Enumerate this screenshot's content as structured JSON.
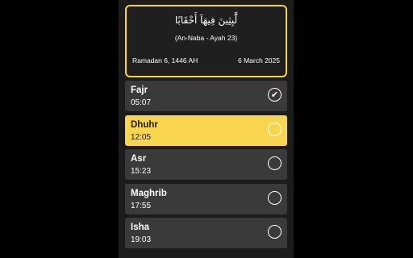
{
  "header": {
    "verse": "لَّٰبِثِينَ فِيهَآ أَحْقَابًا",
    "reference": "(An-Naba - Ayah 23)",
    "hijri_date": "Ramadan 6, 1446 AH",
    "gregorian_date": "6 March 2025"
  },
  "prayers": [
    {
      "name": "Fajr",
      "time": "05:07",
      "checked": true,
      "check_glyph": "✔"
    },
    {
      "name": "Dhuhr",
      "time": "12:05",
      "checked": false,
      "active": true,
      "check_glyph": ""
    },
    {
      "name": "Asr",
      "time": "15:23",
      "checked": false,
      "check_glyph": ""
    },
    {
      "name": "Maghrib",
      "time": "17:55",
      "checked": false,
      "check_glyph": ""
    },
    {
      "name": "Isha",
      "time": "19:03",
      "checked": false,
      "check_glyph": ""
    }
  ],
  "colors": {
    "accent": "#f9d54d",
    "card_border": "#f5d547",
    "row_background": "#3a3a3a",
    "app_background": "#1c1c1c",
    "page_background": "#000000"
  },
  "icons": {
    "check": "check-circle-icon"
  }
}
